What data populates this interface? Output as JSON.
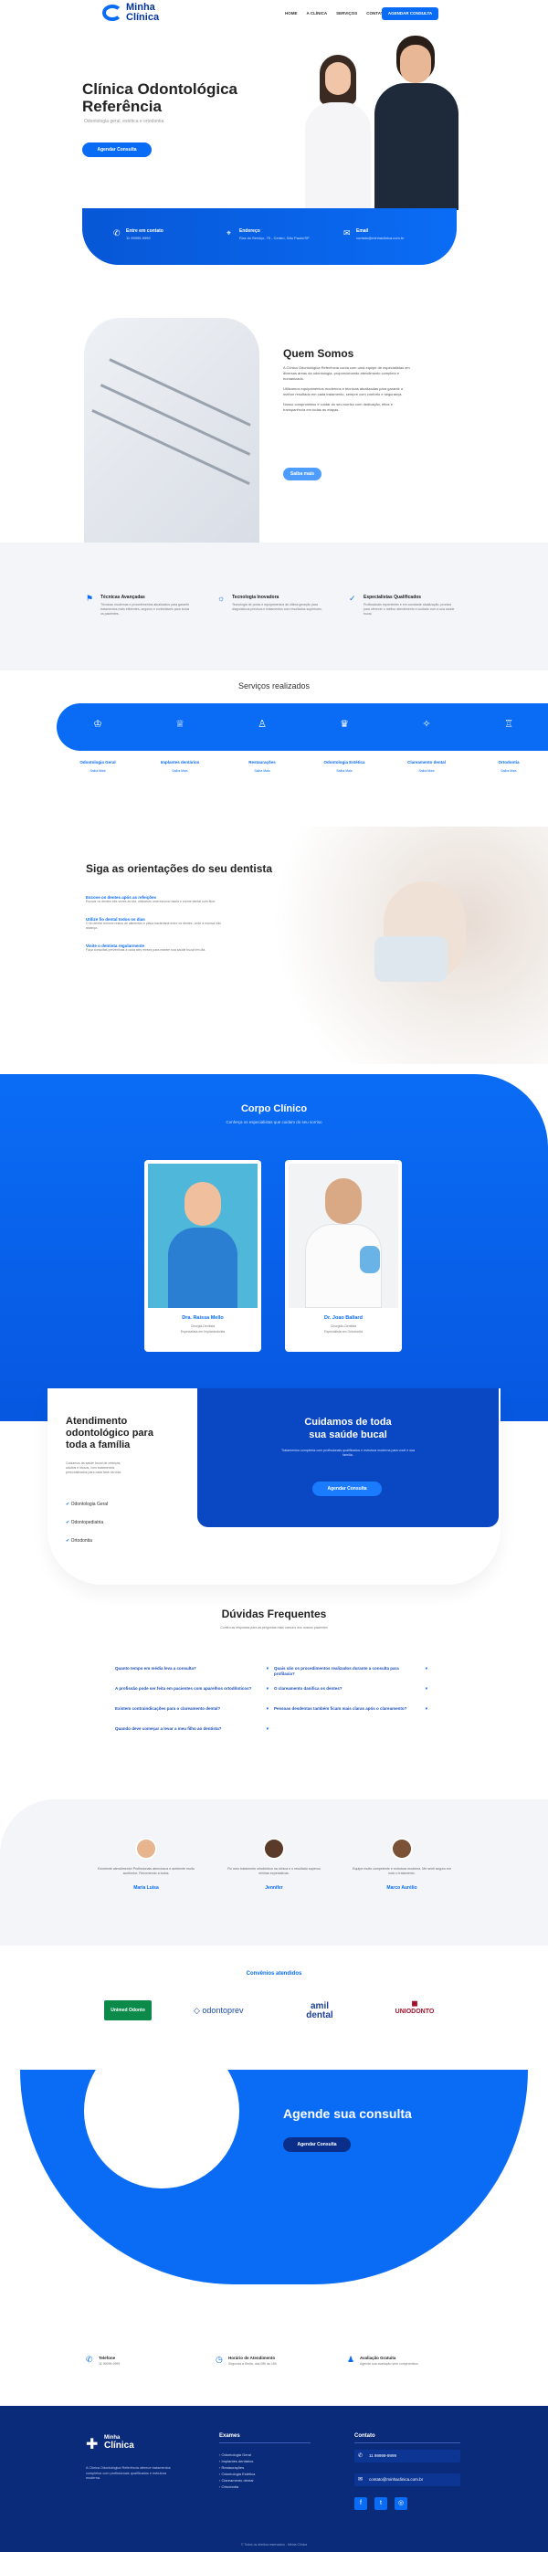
{
  "nav": {
    "brand_line1": "Minha",
    "brand_line2": "Clínica",
    "items": [
      "HOME",
      "A CLÍNICA",
      "SERVIÇOS",
      "CONTATO"
    ],
    "cta": "AGENDAR CONSULTA"
  },
  "hero": {
    "title_line1": "Clínica Odontológica",
    "title_line2": "Referência",
    "subtitle": "Odontologia geral, estética e ortodontia",
    "button": "Agendar Consulta"
  },
  "contact_bar": [
    {
      "icon": "phone-icon",
      "title": "Entre em contato",
      "text": "11 99999-9999"
    },
    {
      "icon": "location-icon",
      "title": "Endereço",
      "text": "Rua do Serviço, 75 - Centro, São Paulo/SP"
    },
    {
      "icon": "mail-icon",
      "title": "Email",
      "text": "contato@minhaclinica.com.br"
    }
  ],
  "about": {
    "title": "Quem Somos",
    "p1": "A Clínica Odontológica Referência conta com uma equipe de especialistas em diversas áreas da odontologia, proporcionando atendimento completo e humanizado.",
    "p2": "Utilizamos equipamentos modernos e técnicas atualizadas para garantir o melhor resultado em cada tratamento, sempre com conforto e segurança.",
    "p3": "Nosso compromisso é cuidar do seu sorriso com dedicação, ética e transparência em todas as etapas.",
    "button": "Saiba mais"
  },
  "features": [
    {
      "icon": "bookmark-icon",
      "title": "Técnicas Avançadas",
      "text": "Técnicas modernas e procedimentos atualizados para garantir tratamentos mais eficientes, seguros e confortáveis para todos os pacientes."
    },
    {
      "icon": "bulb-icon",
      "title": "Tecnologia Inovadora",
      "text": "Tecnologia de ponta e equipamentos de última geração para diagnósticos precisos e tratamentos com resultados superiores."
    },
    {
      "icon": "thumb-icon",
      "title": "Especialistas Qualificados",
      "text": "Profissionais experientes e em constante atualização, prontos para oferecer o melhor atendimento e cuidado com a sua saúde bucal."
    }
  ],
  "services": {
    "heading": "Serviços realizados",
    "more": "Saiba Mais",
    "items": [
      "Odontologia Geral",
      "Implantes dentários",
      "Restaurações",
      "Odontologia Estética",
      "Clareamento dental",
      "Ortodontia"
    ]
  },
  "tips": {
    "title": "Siga as orientações do seu dentista",
    "items": [
      {
        "title": "Escove os dentes após as refeições",
        "text": "Escove os dentes três vezes ao dia, utilizando uma escova macia e creme dental com flúor."
      },
      {
        "title": "Utilize fio dental todos os dias",
        "text": "O fio dental remove restos de alimentos e placa bacteriana entre os dentes, onde a escova não alcança."
      },
      {
        "title": "Visite o dentista regularmente",
        "text": "Faça consultas preventivas a cada seis meses para manter sua saúde bucal em dia."
      }
    ]
  },
  "team": {
    "title": "Corpo Clínico",
    "subtitle": "Conheça os especialistas que cuidam do seu sorriso",
    "members": [
      {
        "name": "Dra. Raissa Mello",
        "role": "Cirurgiã-Dentista",
        "spec": "Especialista em Implantodontia"
      },
      {
        "name": "Dr. Joao Ballard",
        "role": "Cirurgião-Dentista",
        "spec": "Especialista em Ortodontia"
      }
    ]
  },
  "care": {
    "title_line1": "Atendimento",
    "title_line2": "odontológico para",
    "title_line3": "toda a família",
    "text": "Cuidamos da saúde bucal de crianças, adultos e idosos, com tratamentos personalizados para cada fase da vida.",
    "checks": [
      "Odontologia Geral",
      "Odontopediatria",
      "Ortodontia"
    ],
    "box_title_line1": "Cuidamos de toda",
    "box_title_line2": "sua saúde bucal",
    "box_text": "Tratamentos completos com profissionais qualificados e estrutura moderna para você e sua família.",
    "box_button": "Agendar Consulta"
  },
  "faq": {
    "title": "Dúvidas Frequentes",
    "subtitle": "Confira as respostas para as perguntas mais comuns dos nossos pacientes",
    "left": [
      "Quanto tempo em média leva a consulta?",
      "A profissão pode ser feita em pacientes com aparelhos ortodônticos?",
      "Existem contraindicações para o clareamento dental?",
      "Quando deve começar a levar a meu filho ao dentista?"
    ],
    "right": [
      "Quais são os procedimentos realizados durante a consulta para profilaxia?",
      "O clareamento danifica os dentes?",
      "Pessoas desdentas também ficam mais claras após o clareamento?"
    ]
  },
  "testimonials": [
    {
      "text": "Excelente atendimento! Profissionais atenciosos e ambiente muito acolhedor. Recomendo a todos.",
      "name": "Maria Luisa"
    },
    {
      "text": "Fiz meu tratamento ortodôntico na clínica e o resultado superou minhas expectativas.",
      "name": "Jennifer"
    },
    {
      "text": "Equipe muito competente e estrutura moderna. Me senti seguro em todo o tratamento.",
      "name": "Marco Aurélio"
    }
  ],
  "insurers": {
    "title": "Convênios atendidos",
    "items": [
      "Unimed Odonto",
      "odontoprev",
      "amil dental",
      "UNIODONTO"
    ]
  },
  "booking": {
    "title": "Agende sua consulta",
    "button": "Agendar Consulta"
  },
  "info": [
    {
      "title": "Telefone",
      "text": "11 99999-9999"
    },
    {
      "title": "Horário de Atendimento",
      "text": "Segunda a Sexta, das 08h às 18h"
    },
    {
      "title": "Avaliação Gratuita",
      "text": "Agende sua avaliação sem compromisso"
    }
  ],
  "footer": {
    "brand_line1": "Minha",
    "brand_line2": "Clínica",
    "about": "A Clínica Odontológica Referência oferece tratamentos completos com profissionais qualificados e estrutura moderna.",
    "col1_title": "Exames",
    "col1": [
      "Odontologia Geral",
      "Implantes dentários",
      "Restaurações",
      "Odontologia Estética",
      "Clareamento dental",
      "Ortodontia"
    ],
    "col2_title": "Contato",
    "phone": "11 99999-9999",
    "email": "contato@minhaclinica.com.br",
    "copyright": "© Todos os direitos reservados - Minha Clínica"
  },
  "colors": {
    "primary": "#0a6cf5",
    "dark": "#06359a"
  }
}
